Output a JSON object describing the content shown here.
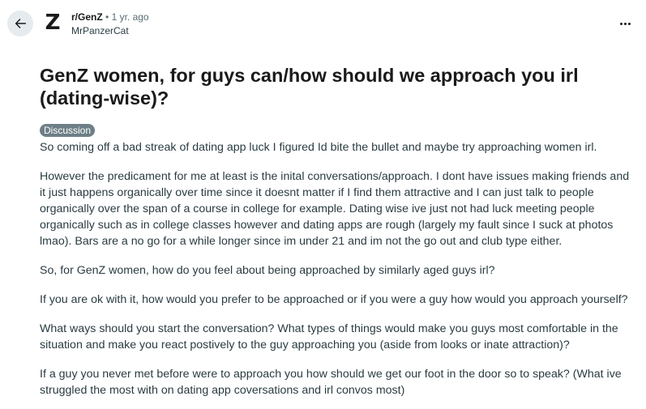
{
  "header": {
    "back_icon": "arrow-left-icon",
    "subreddit_avatar_glyph": "Z",
    "subreddit": "r/GenZ",
    "separator": "•",
    "time_ago": "1 yr. ago",
    "author": "MrPanzerCat",
    "more_icon": "ellipsis-horizontal-icon"
  },
  "post": {
    "title": "GenZ women, for guys can/how should we approach you irl (dating-wise)?",
    "flair": "Discussion",
    "flair_color": "#6e7f87",
    "paragraphs": [
      "So coming off a bad streak of dating app luck I figured Id bite the bullet and maybe try approaching women irl.",
      "However the predicament for me at least is the inital conversations/approach. I dont have issues making friends and it just happens organically over time since it doesnt matter if I find them attractive and I can just talk to people organically over the span of a course in college for example. Dating wise ive just not had luck meeting people organically such as in college classes however and dating apps are rough (largely my fault since I suck at photos lmao). Bars are a no go for a while longer since im under 21 and im not the go out and club type either.",
      "So, for GenZ women, how do you feel about being approached by similarly aged guys irl?",
      "If you are ok with it, how would you prefer to be approached or if you were a guy how would you approach yourself?",
      "What ways should you start the conversation? What types of things would make you guys most comfortable in the situation and make you react postively to the guy approaching you (aside from looks or inate attraction)?",
      "If a guy you never met before were to approach you how should we get our foot in the door so to speak? (What ive struggled the most with on dating app coversations and irl convos most)"
    ]
  }
}
